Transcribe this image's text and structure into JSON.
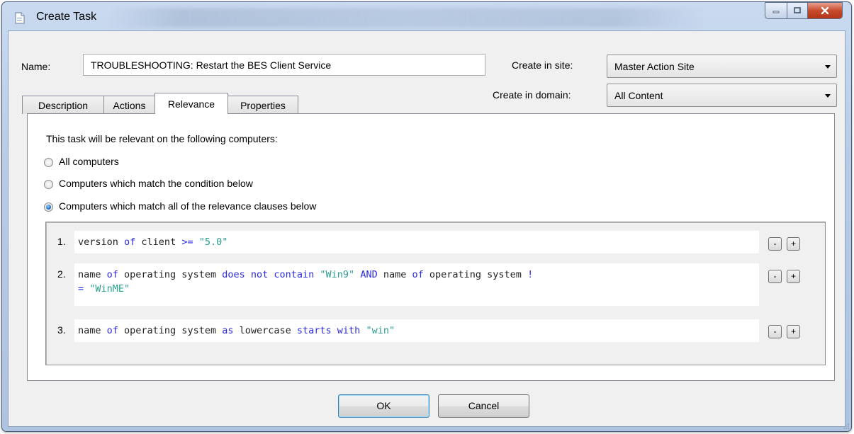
{
  "window": {
    "title": "Create Task"
  },
  "form": {
    "name_label": "Name:",
    "name_value": "TROUBLESHOOTING: Restart the BES Client Service",
    "site_label": "Create in site:",
    "site_value": "Master Action Site",
    "domain_label": "Create in domain:",
    "domain_value": "All Content"
  },
  "tabs": [
    {
      "label": "Description"
    },
    {
      "label": "Actions"
    },
    {
      "label": "Relevance",
      "active": true
    },
    {
      "label": "Properties"
    }
  ],
  "relevance": {
    "intro": "This task will be relevant on the following computers:",
    "options": [
      {
        "label": "All computers",
        "selected": false
      },
      {
        "label": "Computers which match the condition below",
        "selected": false
      },
      {
        "label": "Computers which match all of the relevance clauses below",
        "selected": true
      }
    ],
    "clauses": [
      {
        "number": "1.",
        "tokens": [
          {
            "t": "version ",
            "c": "txt"
          },
          {
            "t": "of",
            "c": "kw"
          },
          {
            "t": " client ",
            "c": "txt"
          },
          {
            "t": ">=",
            "c": "kw"
          },
          {
            "t": " ",
            "c": "txt"
          },
          {
            "t": "\"5.0\"",
            "c": "str"
          }
        ]
      },
      {
        "number": "2.",
        "tokens": [
          {
            "t": "name ",
            "c": "txt"
          },
          {
            "t": "of",
            "c": "kw"
          },
          {
            "t": " operating system ",
            "c": "txt"
          },
          {
            "t": "does not contain",
            "c": "kw"
          },
          {
            "t": " ",
            "c": "txt"
          },
          {
            "t": "\"Win9\"",
            "c": "str"
          },
          {
            "t": " ",
            "c": "txt"
          },
          {
            "t": "AND",
            "c": "kw"
          },
          {
            "t": " name ",
            "c": "txt"
          },
          {
            "t": "of",
            "c": "kw"
          },
          {
            "t": " operating system ",
            "c": "txt"
          },
          {
            "t": "!\n=",
            "c": "kw"
          },
          {
            "t": " ",
            "c": "txt"
          },
          {
            "t": "\"WinME\"",
            "c": "str"
          }
        ]
      },
      {
        "number": "3.",
        "tokens": [
          {
            "t": "name ",
            "c": "txt"
          },
          {
            "t": "of",
            "c": "kw"
          },
          {
            "t": " operating system ",
            "c": "txt"
          },
          {
            "t": "as",
            "c": "kw"
          },
          {
            "t": " lowercase ",
            "c": "txt"
          },
          {
            "t": "starts with",
            "c": "kw"
          },
          {
            "t": " ",
            "c": "txt"
          },
          {
            "t": "\"win\"",
            "c": "str"
          }
        ]
      }
    ],
    "remove_label": "-",
    "add_label": "+"
  },
  "buttons": {
    "ok": "OK",
    "cancel": "Cancel"
  },
  "colors": {
    "keyword": "#2b2be0",
    "string": "#2a9d8f",
    "text": "#222222"
  }
}
